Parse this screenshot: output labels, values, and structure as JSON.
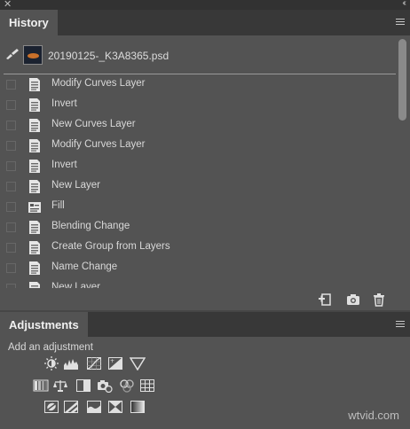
{
  "history": {
    "tab_label": "History",
    "snapshot_name": "20190125-_K3A8365.psd",
    "states": [
      {
        "label": "Modify Curves Layer",
        "icon": "document-state-icon"
      },
      {
        "label": "Invert",
        "icon": "document-state-icon"
      },
      {
        "label": "New Curves Layer",
        "icon": "document-state-icon"
      },
      {
        "label": "Modify Curves Layer",
        "icon": "document-state-icon"
      },
      {
        "label": "Invert",
        "icon": "document-state-icon"
      },
      {
        "label": "New Layer",
        "icon": "document-state-icon"
      },
      {
        "label": "Fill",
        "icon": "fill-state-icon"
      },
      {
        "label": "Blending Change",
        "icon": "document-state-icon"
      },
      {
        "label": "Create Group from Layers",
        "icon": "document-state-icon"
      },
      {
        "label": "Name Change",
        "icon": "document-state-icon"
      },
      {
        "label": "New Layer",
        "icon": "document-state-icon"
      }
    ]
  },
  "adjustments": {
    "tab_label": "Adjustments",
    "add_label": "Add an adjustment",
    "rows": [
      [
        "brightness-contrast-icon",
        "levels-icon",
        "curves-icon",
        "exposure-icon",
        "gradient-map-triangle-icon"
      ],
      [
        "vibrance-icon",
        "color-balance-icon",
        "black-white-icon",
        "photo-filter-icon",
        "channel-mixer-icon",
        "color-lookup-icon"
      ],
      [
        "invert-icon",
        "posterize-icon",
        "threshold-icon",
        "selective-color-icon",
        "gradient-map-icon"
      ]
    ]
  },
  "watermark": "wtvid.com",
  "colors": {
    "panel": "#535353",
    "header": "#383838",
    "background": "#464646"
  }
}
